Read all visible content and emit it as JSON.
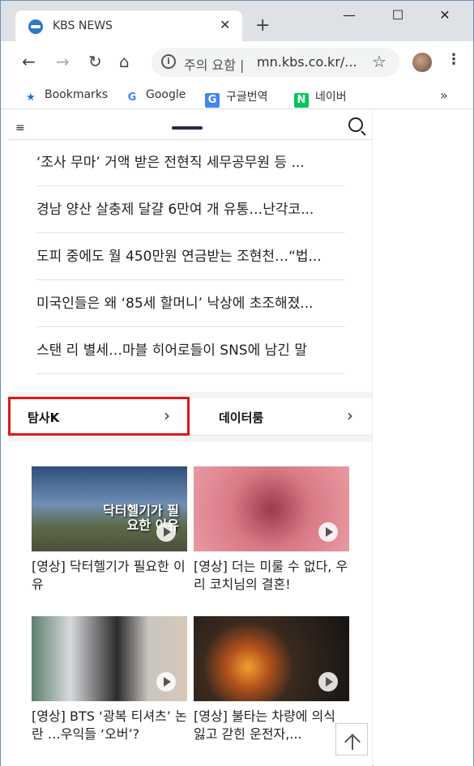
{
  "browser": {
    "tab_title": "KBS NEWS",
    "tab_close": "✕",
    "new_tab": "+",
    "minimize": "—",
    "maximize": "☐",
    "close": "✕",
    "back": "←",
    "forward": "→",
    "reload": "↻",
    "home": "⌂",
    "omnibox_warning": "주의 요함 |",
    "omnibox_url": "mn.kbs.co.kr/...",
    "star": "☆",
    "menu": "⋮",
    "bookmarks": [
      {
        "label": "Bookmarks",
        "icon": "star-icon",
        "glyph": "★",
        "color": "#1a73e8"
      },
      {
        "label": "Google",
        "icon": "google-icon",
        "glyph": "G",
        "color": "#4285f4"
      },
      {
        "label": "구글번역",
        "icon": "translate-icon",
        "glyph": "G",
        "color": "#4285f4"
      },
      {
        "label": "네이버",
        "icon": "naver-icon",
        "glyph": "N",
        "color": "#03c75a"
      }
    ],
    "more": "»"
  },
  "page": {
    "menu_glyph": "≡",
    "news": [
      "‘조사 무마’ 거액 받은 전현직 세무공무원 등 ...",
      "경남 양산 살충제 달걀 6만여 개 유통…난각코...",
      "도피 중에도 월 450만원 연금받는 조현천…“법...",
      "미국인들은 왜 ‘85세 할머니’ 낙상에 초조해졌...",
      "스탠 리 별세…마블 히어로들이 SNS에 남긴 말"
    ],
    "categories": [
      {
        "label": "탐사K",
        "arrow": "›"
      },
      {
        "label": "데이터룸",
        "arrow": "›"
      }
    ],
    "videos": [
      {
        "title": "[영상] 닥터헬기가 필요한 이유",
        "overlay": "닥터헬기가 필요한 이유"
      },
      {
        "title": "[영상] 더는 미룰 수 없다, 우리 코치님의 결혼!",
        "overlay": ""
      },
      {
        "title": "[영상] BTS ‘광복 티셔츠’ 논란 …우익들 ‘오버’?",
        "overlay": ""
      },
      {
        "title": "[영상] 불타는 차량에 의식 잃고 갇힌 운전자,...",
        "overlay": ""
      }
    ],
    "colors": {
      "highlight": "#e0161b",
      "logo": "#232c4d"
    }
  }
}
